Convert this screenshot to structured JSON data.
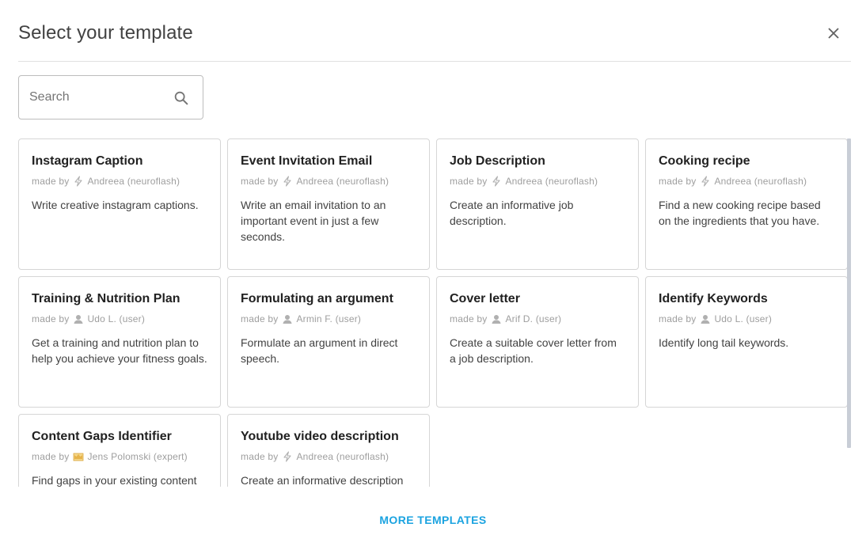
{
  "dialog": {
    "title": "Select your template",
    "close_icon": "close-icon"
  },
  "search": {
    "placeholder": "Search",
    "value": "",
    "icon": "search-icon"
  },
  "made_by_label": "made by",
  "templates": [
    {
      "title": "Instagram Caption",
      "author": "Andreea (neuroflash)",
      "author_icon": "lightning-icon",
      "description": "Write creative instagram captions."
    },
    {
      "title": "Event Invitation Email",
      "author": "Andreea (neuroflash)",
      "author_icon": "lightning-icon",
      "description": "Write an email invitation to an important event in just a few seconds."
    },
    {
      "title": "Job Description",
      "author": "Andreea (neuroflash)",
      "author_icon": "lightning-icon",
      "description": "Create an informative job description."
    },
    {
      "title": "Cooking recipe",
      "author": "Andreea (neuroflash)",
      "author_icon": "lightning-icon",
      "description": "Find a new cooking recipe based on the ingredients that you have."
    },
    {
      "title": "Training & Nutrition Plan",
      "author": "Udo L. (user)",
      "author_icon": "user-icon",
      "description": "Get a training and nutrition plan to help you achieve your fitness goals."
    },
    {
      "title": "Formulating an argument",
      "author": "Armin F. (user)",
      "author_icon": "user-icon",
      "description": "Formulate an argument in direct speech."
    },
    {
      "title": "Cover letter",
      "author": "Arif D. (user)",
      "author_icon": "user-icon",
      "description": "Create a suitable cover letter from a job description."
    },
    {
      "title": "Identify Keywords",
      "author": "Udo L. (user)",
      "author_icon": "user-icon",
      "description": "Identify long tail keywords."
    },
    {
      "title": "Content Gaps Identifier",
      "author": "Jens Polomski (expert)",
      "author_icon": "crown-icon",
      "description": "Find gaps in your existing content"
    },
    {
      "title": "Youtube video description",
      "author": "Andreea (neuroflash)",
      "author_icon": "lightning-icon",
      "description": "Create an informative description"
    }
  ],
  "footer": {
    "more_label": "MORE TEMPLATES"
  },
  "colors": {
    "accent": "#1ba3e0",
    "card_border": "#d6d6d6",
    "muted_text": "#9e9e9e"
  }
}
